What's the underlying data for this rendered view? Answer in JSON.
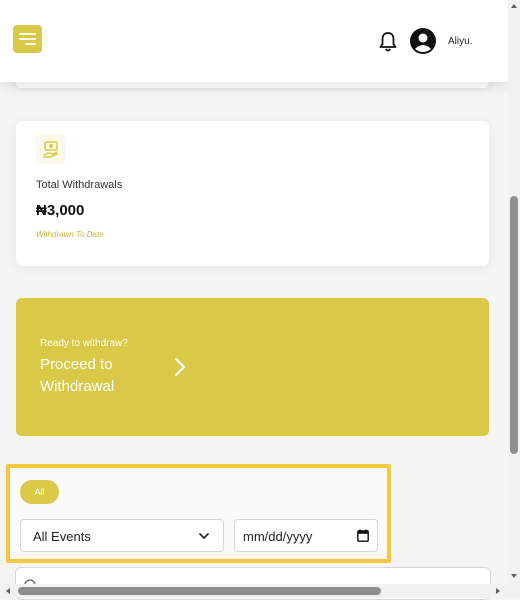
{
  "header": {
    "user_name": "Aliyu."
  },
  "stats_card": {
    "title": "Total Withdrawals",
    "amount": "₦3,000",
    "subtitle": "Withdrawn To Date"
  },
  "cta": {
    "small_text": "Ready to withdraw?",
    "big_text": "Proceed to Withdrawal"
  },
  "filters": {
    "pill_label": "All",
    "event_select_value": "All Events",
    "date_placeholder": "mm/dd/yyyy"
  },
  "colors": {
    "accent": "#d9c947",
    "highlight_border": "#f5c842",
    "subtitle": "#c9b63a"
  },
  "icons": [
    "menu-icon",
    "bell-icon",
    "user-avatar-icon",
    "money-hand-icon",
    "chevron-right-icon",
    "chevron-down-icon",
    "calendar-icon",
    "search-icon"
  ]
}
